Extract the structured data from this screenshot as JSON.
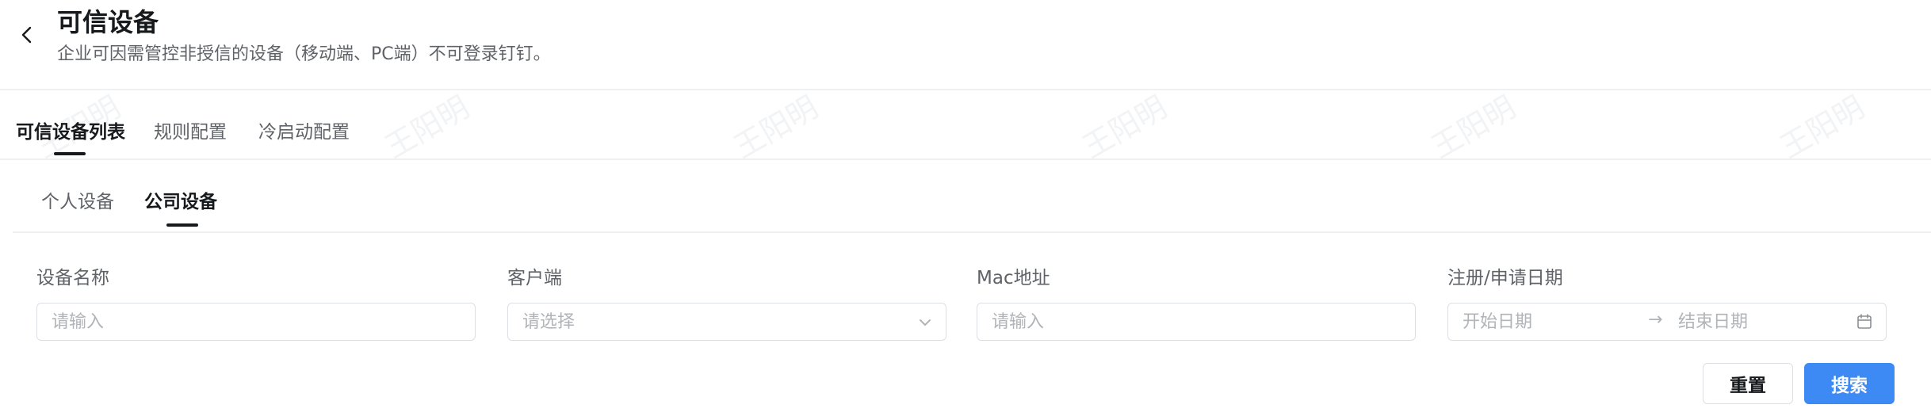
{
  "header": {
    "title": "可信设备",
    "subtitle": "企业可因需管控非授信的设备（移动端、PC端）不可登录钉钉。",
    "back_icon": "chevron-left-icon"
  },
  "tabs": [
    {
      "label": "可信设备列表",
      "active": true
    },
    {
      "label": "规则配置",
      "active": false
    },
    {
      "label": "冷启动配置",
      "active": false
    }
  ],
  "subtabs": [
    {
      "label": "个人设备",
      "active": false
    },
    {
      "label": "公司设备",
      "active": true
    }
  ],
  "filters": {
    "device_name": {
      "label": "设备名称",
      "placeholder": "请输入"
    },
    "client": {
      "label": "客户端",
      "placeholder": "请选择"
    },
    "mac": {
      "label": "Mac地址",
      "placeholder": "请输入"
    },
    "date": {
      "label": "注册/申请日期",
      "start_placeholder": "开始日期",
      "end_placeholder": "结束日期",
      "separator": "→"
    }
  },
  "buttons": {
    "reset": "重置",
    "search": "搜索"
  },
  "watermark": "王阳明",
  "colors": {
    "primary": "#3d8af5",
    "text": "#171a1d",
    "muted": "#5f6368",
    "border": "#dcdfe3"
  }
}
